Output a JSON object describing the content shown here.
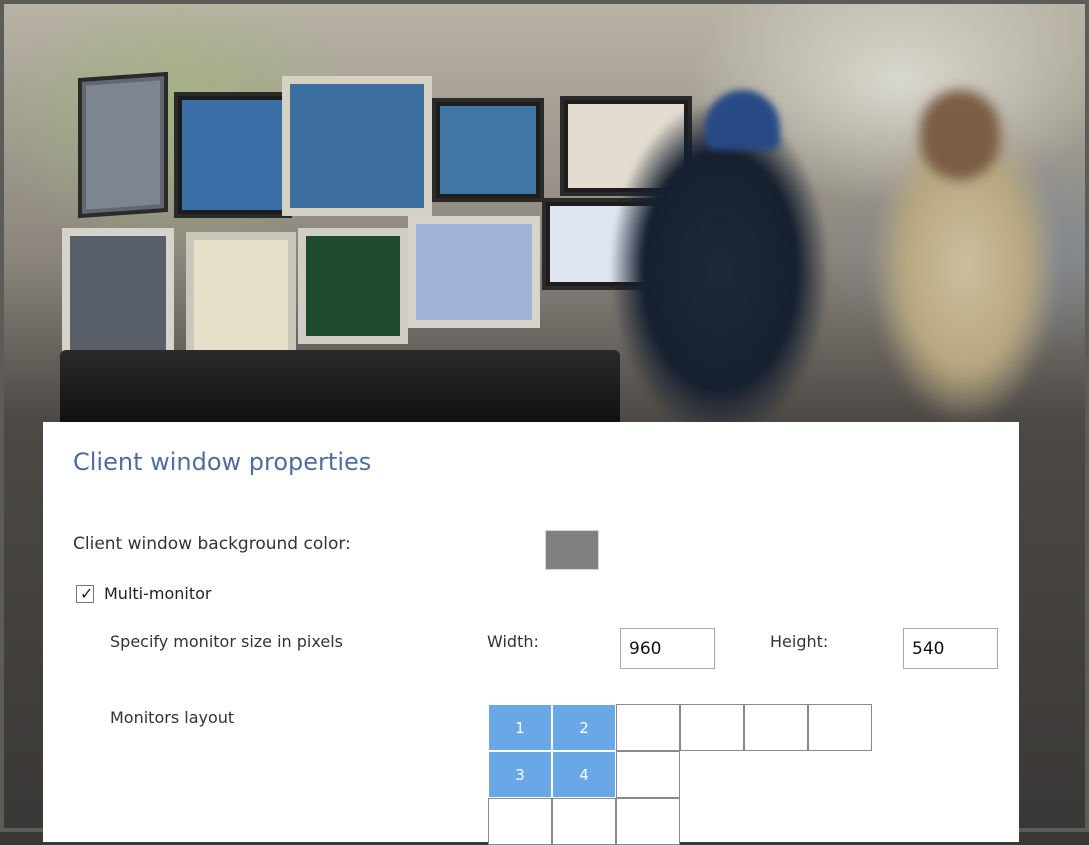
{
  "dialog": {
    "title": "Client window properties",
    "background_color_label": "Client window background color:",
    "background_color_value": "#808080",
    "multi_monitor": {
      "label": "Multi-monitor",
      "checked": true,
      "check_glyph": "✓"
    },
    "monitor_size": {
      "label": "Specify monitor size in pixels",
      "width_label": "Width:",
      "width_value": "960",
      "height_label": "Height:",
      "height_value": "540"
    },
    "monitors_layout": {
      "label": "Monitors layout",
      "selected_color": "#6aa7e6",
      "rows": [
        [
          "1",
          "2",
          "",
          "",
          "",
          ""
        ],
        [
          "3",
          "4",
          ""
        ],
        [
          "",
          "",
          ""
        ]
      ],
      "selected": [
        [
          true,
          true,
          false,
          false,
          false,
          false
        ],
        [
          true,
          true,
          false
        ],
        [
          false,
          false,
          false
        ]
      ]
    }
  }
}
